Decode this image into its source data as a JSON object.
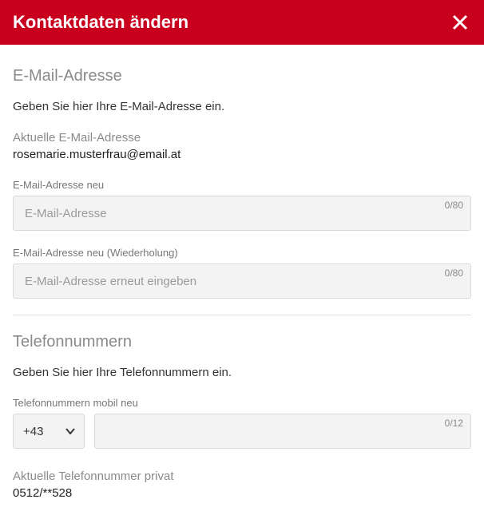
{
  "header": {
    "title": "Kontaktdaten ändern"
  },
  "email_section": {
    "heading": "E-Mail-Adresse",
    "description": "Geben Sie hier Ihre E-Mail-Adresse ein.",
    "current_label": "Aktuelle E-Mail-Adresse",
    "current_value": "rosemarie.musterfrau@email.at",
    "new_label": "E-Mail-Adresse neu",
    "new_placeholder": "E-Mail-Adresse",
    "new_counter": "0/80",
    "repeat_label": "E-Mail-Adresse neu (Wiederholung)",
    "repeat_placeholder": "E-Mail-Adresse erneut eingeben",
    "repeat_counter": "0/80"
  },
  "phone_section": {
    "heading": "Telefonnummern",
    "description": "Geben Sie hier Ihre Telefonnummern ein.",
    "mobile_label": "Telefonnummern mobil neu",
    "country_code": "+43",
    "mobile_counter": "0/12",
    "current_private_label": "Aktuelle Telefonnummer privat",
    "current_private_value": "0512/**528"
  }
}
